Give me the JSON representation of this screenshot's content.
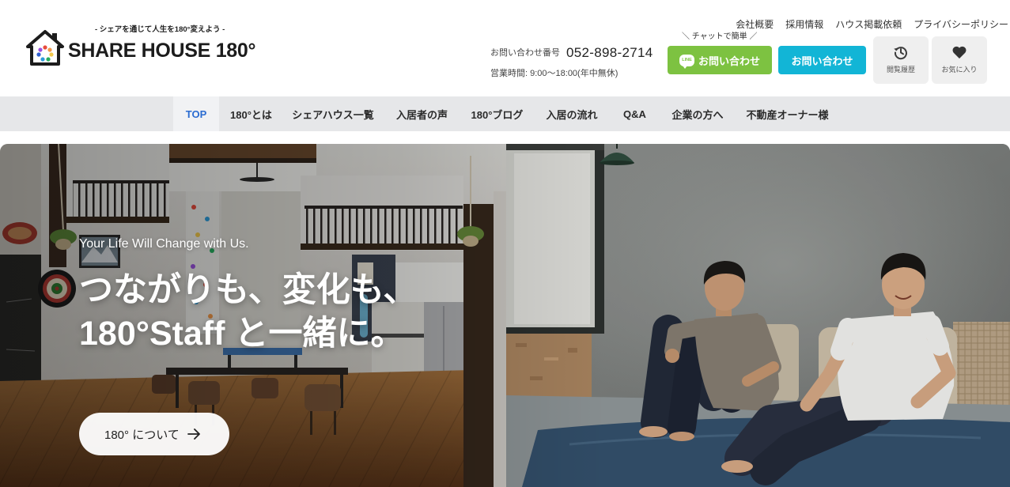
{
  "header": {
    "tagline": "- シェアを通じて人生を180°変えよう -",
    "logo_text": "SHARE HOUSE 180°",
    "logo_icon": "house-logo-icon",
    "top_links": [
      {
        "label": "会社概要"
      },
      {
        "label": "採用情報"
      },
      {
        "label": "ハウス掲載依頼"
      },
      {
        "label": "プライバシーポリシー"
      }
    ],
    "phone": {
      "label": "お問い合わせ番号",
      "number": "052-898-2714",
      "hours": "営業時間: 9:00〜18:00(年中無休)"
    },
    "chat_note": "＼ チャットで簡単 ／",
    "line_button": {
      "badge": "LINE",
      "label": "お問い合わせ",
      "icon": "line-icon"
    },
    "contact_button": {
      "label": "お問い合わせ"
    },
    "history_button": {
      "label": "閲覧履歴",
      "icon": "history-icon"
    },
    "favorites_button": {
      "label": "お気に入り",
      "icon": "heart-icon"
    }
  },
  "nav": {
    "active_index": 0,
    "items": [
      "TOP",
      "180°とは",
      "シェアハウス一覧",
      "入居者の声",
      "180°ブログ",
      "入居の流れ",
      "Q&A",
      "企業の方へ",
      "不動産オーナー様"
    ]
  },
  "hero": {
    "subtitle": "Your Life Will Change with Us.",
    "heading_lines": [
      "つながりも、変化も、",
      "180°Staff と一緒に。"
    ],
    "cta": {
      "label": "180° について",
      "icon": "arrow-right-icon"
    }
  },
  "colors": {
    "line_green": "#7dc241",
    "contact_cyan": "#12b5d6",
    "nav_active_text": "#2b6cd1",
    "nav_background": "#e6e7e9",
    "text": "#333333"
  }
}
